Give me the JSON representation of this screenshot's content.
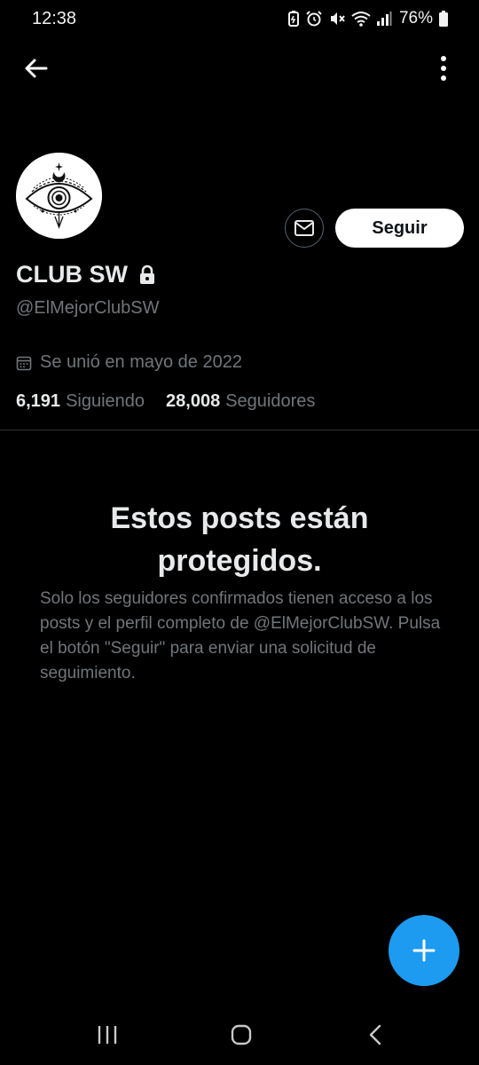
{
  "status_bar": {
    "time": "12:38",
    "battery": "76%",
    "icons": [
      "battery-saver-icon",
      "alarm-icon",
      "mute-icon",
      "wifi-icon",
      "signal-icon",
      "battery-icon"
    ]
  },
  "header": {
    "back_icon": "back-arrow-icon",
    "more_icon": "more-vertical-icon"
  },
  "profile": {
    "display_name": "CLUB SW",
    "handle": "@ElMejorClubSW",
    "joined": "Se unió en mayo de 2022",
    "following_count": "6,191",
    "following_label": "Siguiendo",
    "followers_count": "28,008",
    "followers_label": "Seguidores",
    "follow_button": "Seguir",
    "lock_icon": "lock-icon",
    "message_icon": "envelope-icon"
  },
  "protected": {
    "title": "Estos posts están protegidos.",
    "body": "Solo los seguidores confirmados tienen acceso a los posts y el perfil completo de @ElMejorClubSW. Pulsa el botón \"Seguir\" para enviar una solicitud de seguimiento."
  },
  "fab": {
    "icon": "plus-icon",
    "color": "#1d9bf0"
  },
  "nav": {
    "icons": [
      "recent-apps-icon",
      "home-icon",
      "back-icon"
    ]
  },
  "colors": {
    "background": "#000000",
    "text": "#e7e9ea",
    "muted": "#71767b",
    "accent": "#1d9bf0"
  }
}
